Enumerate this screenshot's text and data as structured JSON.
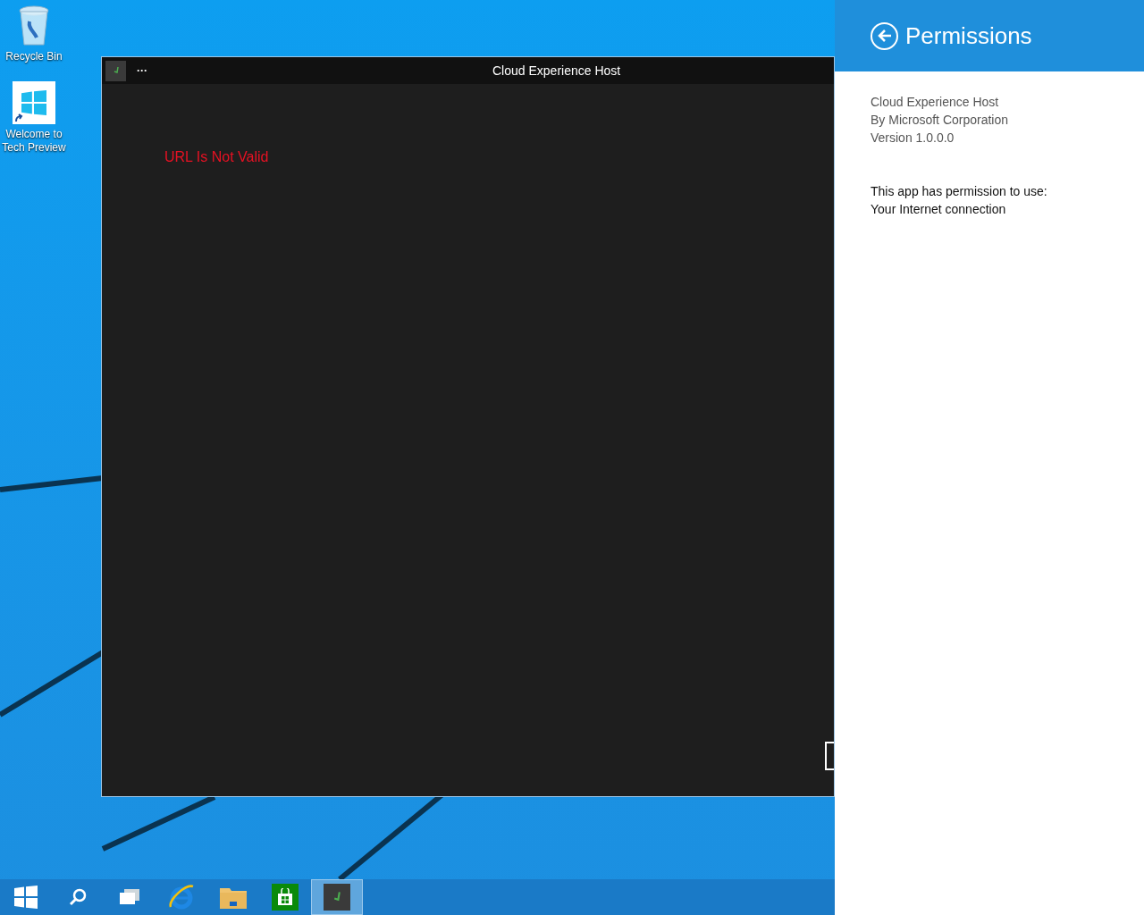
{
  "desktop_icons": [
    {
      "label": "Recycle Bin",
      "kind": "bin"
    },
    {
      "label": "Welcome to Tech Preview",
      "kind": "shortcut"
    }
  ],
  "window": {
    "menu": "···",
    "title": "Cloud Experience Host",
    "error": "URL Is Not Valid"
  },
  "taskbar": [
    {
      "kind": "start",
      "selected": false
    },
    {
      "kind": "search",
      "selected": false
    },
    {
      "kind": "views",
      "selected": false
    },
    {
      "kind": "browser",
      "selected": false
    },
    {
      "kind": "folder",
      "selected": false
    },
    {
      "kind": "store",
      "selected": false
    },
    {
      "kind": "app",
      "selected": true
    }
  ],
  "panel": {
    "title": "Permissions",
    "app_info": [
      "Cloud Experience Host",
      "By Microsoft Corporation",
      "Version 1.0.0.0"
    ],
    "permission_heading": "This app has permission to use:",
    "permissions": [
      "Your Internet connection"
    ]
  }
}
